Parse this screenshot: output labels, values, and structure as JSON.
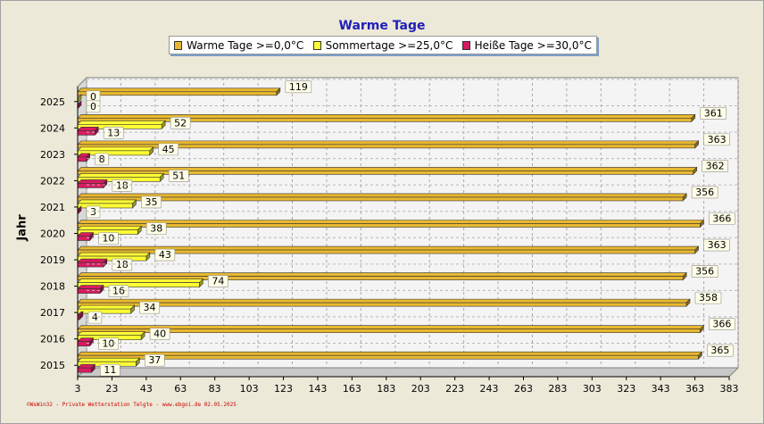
{
  "chart_data": {
    "type": "bar",
    "title": "Warme Tage",
    "ylabel": "Jahr",
    "xlabel": "",
    "xlim": [
      3,
      383
    ],
    "x_ticks": [
      3,
      23,
      43,
      63,
      83,
      103,
      123,
      143,
      163,
      183,
      203,
      223,
      243,
      263,
      283,
      303,
      323,
      343,
      363,
      383
    ],
    "grid": true,
    "legend_position": "top",
    "categories": [
      "2025",
      "2024",
      "2023",
      "2022",
      "2021",
      "2020",
      "2019",
      "2018",
      "2017",
      "2016",
      "2015"
    ],
    "series": [
      {
        "name": "Warme Tage >=0,0°C",
        "color": "#e8b830",
        "values": [
          119,
          361,
          363,
          362,
          356,
          366,
          363,
          356,
          358,
          366,
          365
        ]
      },
      {
        "name": "Sommertage >=25,0°C",
        "color": "#ffff33",
        "values": [
          0,
          52,
          45,
          51,
          35,
          38,
          43,
          74,
          34,
          40,
          37
        ]
      },
      {
        "name": "Heiße Tage >=30,0°C",
        "color": "#d81b60",
        "values": [
          0,
          13,
          8,
          18,
          3,
          10,
          18,
          16,
          4,
          10,
          11
        ]
      }
    ]
  },
  "footer_text": "©WsWin32 - Private Wetterstation Telgte - www.ebgoi.de  02.05.2025"
}
